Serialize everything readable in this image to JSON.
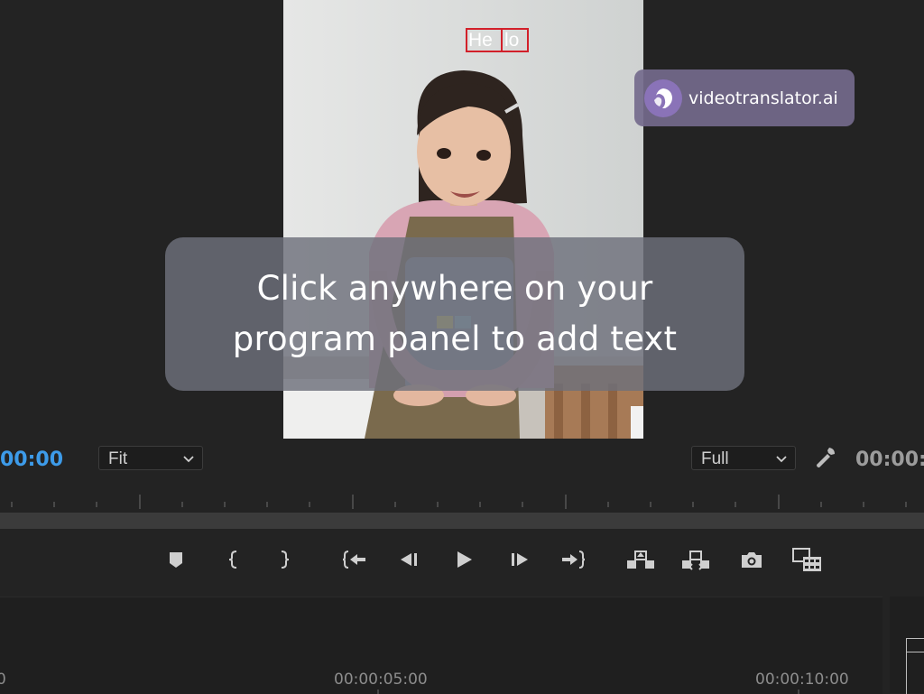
{
  "program_monitor": {
    "overlay_text_left": "He",
    "overlay_text_right": "lo",
    "watermark_text": "videotranslator.ai",
    "hint_line1": "Click anywhere on your",
    "hint_line2": "program panel to add text"
  },
  "controls": {
    "playhead_timecode": "00:00",
    "fit_select": "Fit",
    "resolution_select": "Full",
    "duration_timecode": "00:00:"
  },
  "transport_buttons": [
    "add-marker",
    "mark-in",
    "mark-out",
    "go-to-in",
    "step-back",
    "play",
    "step-forward",
    "go-to-out",
    "lift",
    "extract",
    "export-frame",
    "insert-clip"
  ],
  "timeline": {
    "time_5s": "00:00:05:00",
    "time_10s": "00:00:10:00",
    "time_0": "0"
  },
  "colors": {
    "accent_timecode": "#3d9be9",
    "selection_box": "#d2202a",
    "watermark_bg": "#746a8c",
    "panel_bg": "#232323"
  }
}
